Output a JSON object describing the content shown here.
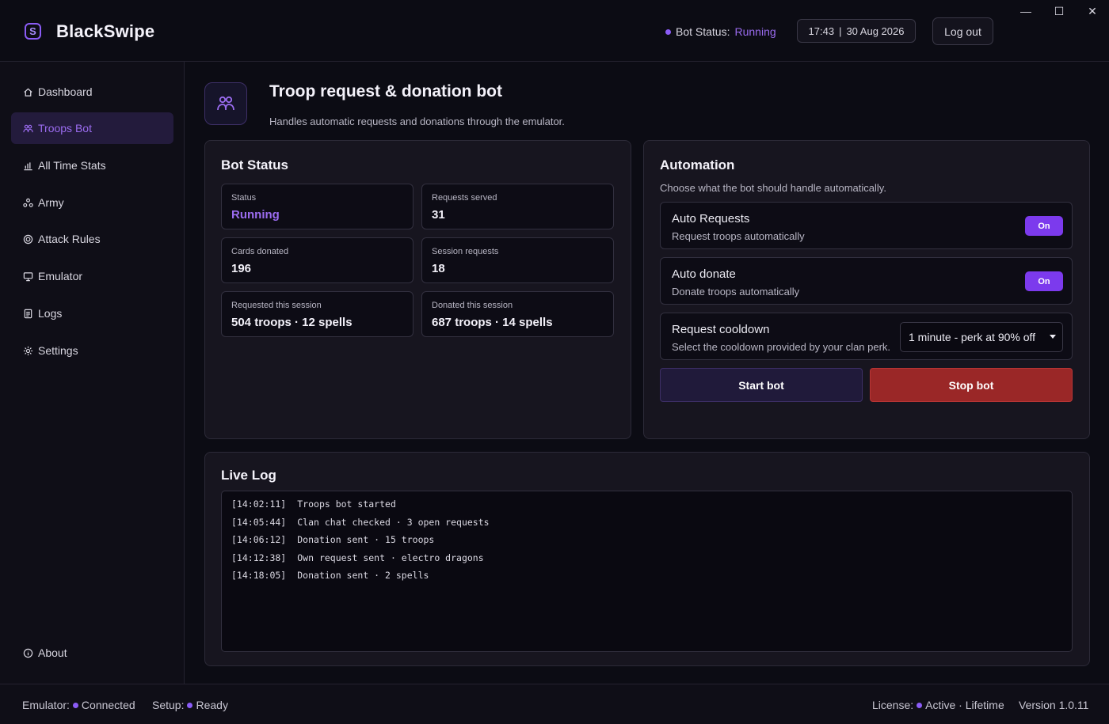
{
  "app": {
    "title": "BlackSwipe",
    "logo_letter": "S"
  },
  "window_controls": {
    "minimize": "—",
    "maximize": "☐",
    "close": "✕"
  },
  "header": {
    "bot_status_label": "Bot Status:",
    "bot_status_value": "Running",
    "time": "17:43",
    "separator": "|",
    "date": "30 Aug 2026",
    "logout_label": "Log out"
  },
  "sidebar": {
    "items": [
      {
        "label": "Dashboard",
        "icon": "home-icon"
      },
      {
        "label": "Troops Bot",
        "icon": "troops-icon"
      },
      {
        "label": "All Time Stats",
        "icon": "chart-icon"
      },
      {
        "label": "Army",
        "icon": "army-icon"
      },
      {
        "label": "Attack Rules",
        "icon": "target-icon"
      },
      {
        "label": "Emulator",
        "icon": "monitor-icon"
      },
      {
        "label": "Logs",
        "icon": "document-icon"
      },
      {
        "label": "Settings",
        "icon": "gear-icon"
      }
    ],
    "active_index": 1,
    "about_label": "About"
  },
  "page": {
    "title": "Troop request & donation bot",
    "subtitle": "Handles automatic requests and donations through the emulator."
  },
  "bot_status_panel": {
    "title": "Bot Status",
    "cards": [
      {
        "label": "Status",
        "value": "Running"
      },
      {
        "label": "Requests served",
        "value": "31"
      },
      {
        "label": "Cards donated",
        "value": "196"
      },
      {
        "label": "Session requests",
        "value": "18"
      },
      {
        "label": "Requested this session",
        "value": "504 troops · 12 spells"
      },
      {
        "label": "Donated this session",
        "value": "687 troops · 14 spells"
      }
    ]
  },
  "automation_panel": {
    "title": "Automation",
    "subtitle": "Choose what the bot should handle automatically.",
    "options": [
      {
        "title": "Auto Requests",
        "desc": "Request troops automatically",
        "toggle": "On"
      },
      {
        "title": "Auto donate",
        "desc": "Donate troops automatically",
        "toggle": "On"
      }
    ],
    "cooldown": {
      "title": "Request cooldown",
      "desc": "Select the cooldown provided by your clan perk.",
      "selected": "1 minute - perk at 90% off"
    },
    "start_label": "Start bot",
    "stop_label": "Stop bot"
  },
  "live_log": {
    "title": "Live Log",
    "lines": [
      {
        "time": "[14:02:11]",
        "text": "Troops bot started"
      },
      {
        "time": "[14:05:44]",
        "text": "Clan chat checked · 3 open requests"
      },
      {
        "time": "[14:06:12]",
        "text": "Donation sent · 15 troops"
      },
      {
        "time": "[14:12:38]",
        "text": "Own request sent · electro dragons"
      },
      {
        "time": "[14:18:05]",
        "text": "Donation sent · 2 spells"
      }
    ]
  },
  "footer": {
    "emulator_label": "Emulator:",
    "emulator_value": "Connected",
    "setup_label": "Setup:",
    "setup_value": "Ready",
    "license_label": "License:",
    "license_value": "Active · Lifetime",
    "version": "Version 1.0.11"
  },
  "colors": {
    "accent": "#8b5cf6",
    "stop": "#9a2727",
    "background": "#0c0c14"
  }
}
